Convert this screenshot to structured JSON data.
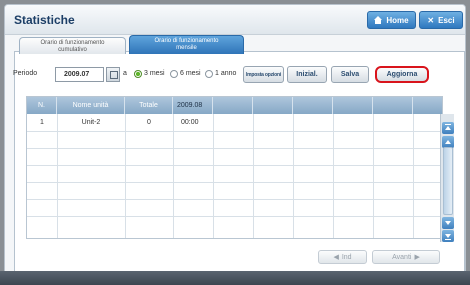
{
  "header": {
    "title": "Statistiche",
    "home_label": "Home",
    "exit_label": "Esci"
  },
  "tabs": [
    {
      "label_line1": "Orario di funzionamento",
      "label_line2": "cumulativo",
      "active": false
    },
    {
      "label_line1": "Orario di funzionamento",
      "label_line2": "mensile",
      "active": true
    }
  ],
  "toolbar": {
    "period_label": "Periodo",
    "period_value": "2009.07",
    "a_label": "a",
    "radio_options": [
      "3 mesi",
      "6 mesi",
      "1 anno"
    ],
    "selected_option": "3 mesi",
    "impostazioni_label": "Imposta opzioni",
    "inizial_label": "Inizial.",
    "salva_label": "Salva",
    "aggiorna_label": "Aggiorna"
  },
  "table": {
    "headers": [
      "N.",
      "Nome unità",
      "Totale",
      "2009.08"
    ],
    "rows": [
      {
        "n": "1",
        "name": "Unit-2",
        "total": "0",
        "month": "00:00"
      }
    ]
  },
  "pager": {
    "prev_label": "Ind",
    "next_label": "Avanti"
  },
  "colors": {
    "accent": "#2f78bf",
    "highlight_border": "#d9141c"
  }
}
